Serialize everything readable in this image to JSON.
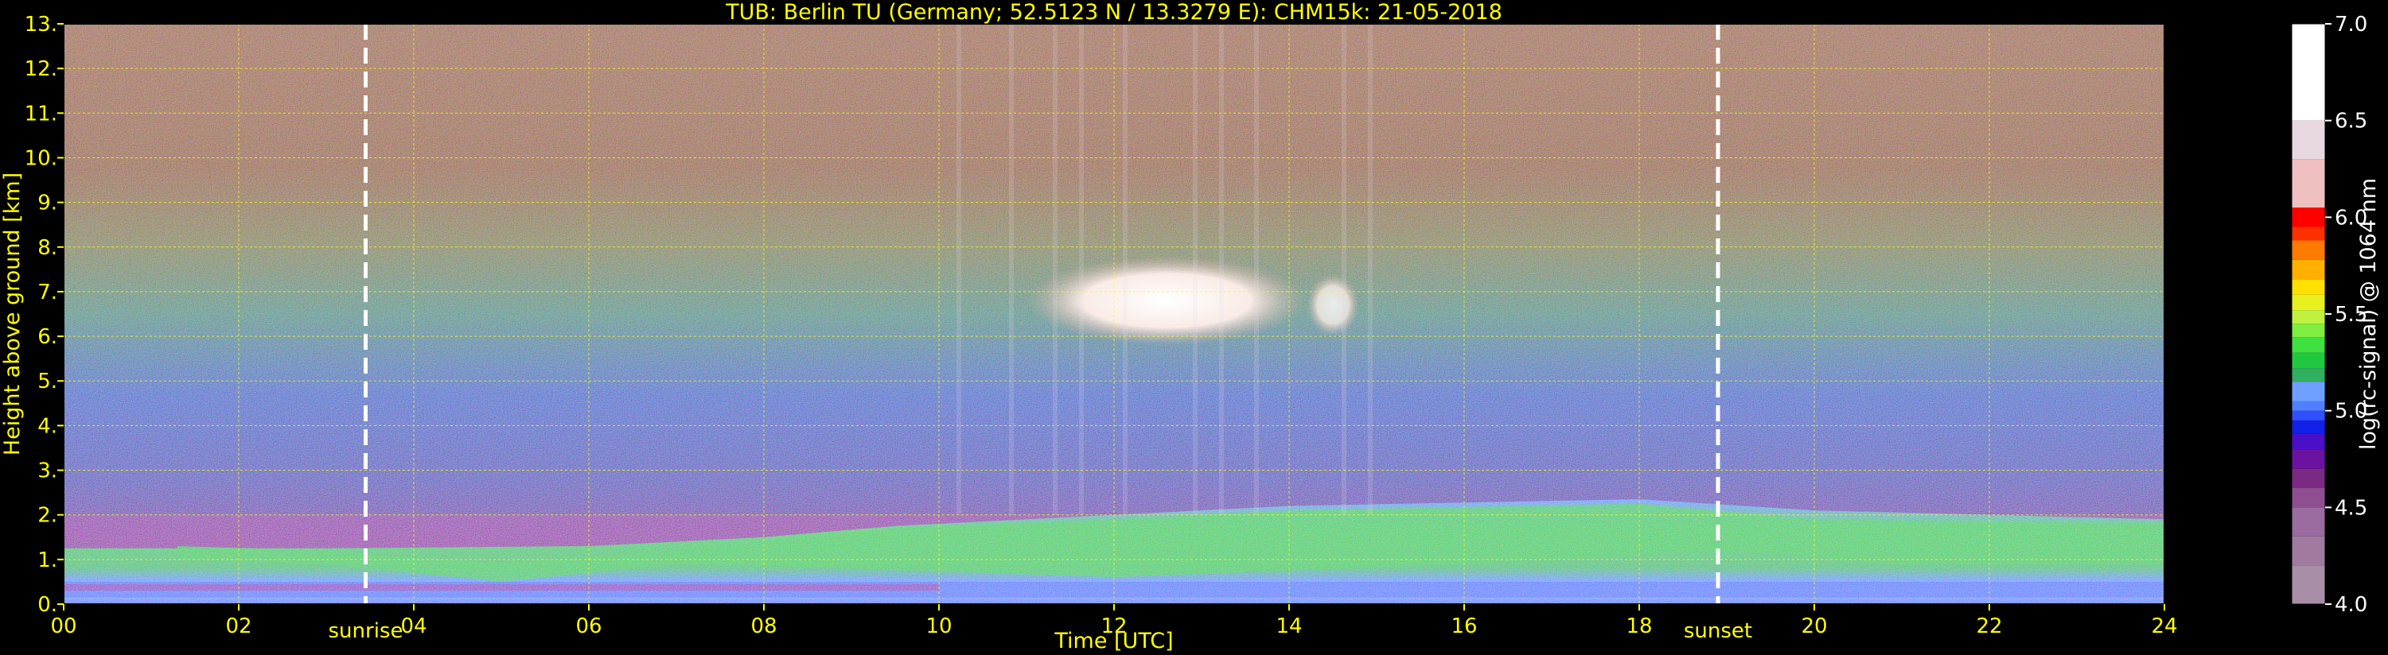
{
  "chart_data": {
    "type": "heatmap",
    "title": "TUB: Berlin TU (Germany; 52.5123 N / 13.3279 E):    CHM15k: 21-05-2018",
    "xlabel": "Time [UTC]",
    "ylabel": "Height above ground [km]",
    "xlim": [
      0,
      24
    ],
    "ylim": [
      0,
      13
    ],
    "x_ticks": [
      "00",
      "02",
      "04",
      "06",
      "08",
      "10",
      "12",
      "14",
      "16",
      "18",
      "20",
      "22",
      "24"
    ],
    "y_ticks": [
      "0.",
      "1.",
      "2.",
      "3.",
      "4.",
      "5.",
      "6.",
      "7.",
      "8.",
      "9.",
      "10.",
      "11.",
      "12.",
      "13."
    ],
    "grid": true,
    "events": [
      {
        "label": "sunrise",
        "time": 3.45
      },
      {
        "label": "sunset",
        "time": 18.9
      }
    ],
    "colorbar": {
      "label": "log(rc-signal) @ 1064 nm",
      "range": [
        4.0,
        7.0
      ],
      "ticks": [
        "4.0",
        "4.5",
        "5.0",
        "5.5",
        "6.0",
        "6.5",
        "7.0"
      ],
      "colors": [
        "#a98ea8",
        "#a07a9f",
        "#9a6ca0",
        "#8e4f91",
        "#7b2a83",
        "#6b12a0",
        "#4a10c8",
        "#1020e8",
        "#3050ff",
        "#5080ff",
        "#70a0ff",
        "#30b060",
        "#20c840",
        "#40e040",
        "#80ee40",
        "#c0f040",
        "#e8f020",
        "#ffe000",
        "#ffb000",
        "#ff7a00",
        "#ff3000",
        "#ff0000",
        "#f0c0c0",
        "#e8d8e0",
        "#ffffff"
      ]
    },
    "features": [
      {
        "type": "aerosol_layer",
        "x_range": [
          0,
          24
        ],
        "top_km": [
          1.25,
          2.3
        ]
      },
      {
        "type": "cirrus_cloud",
        "x_range": [
          11.2,
          15.0
        ],
        "height_km": [
          6.2,
          7.3
        ]
      }
    ]
  }
}
